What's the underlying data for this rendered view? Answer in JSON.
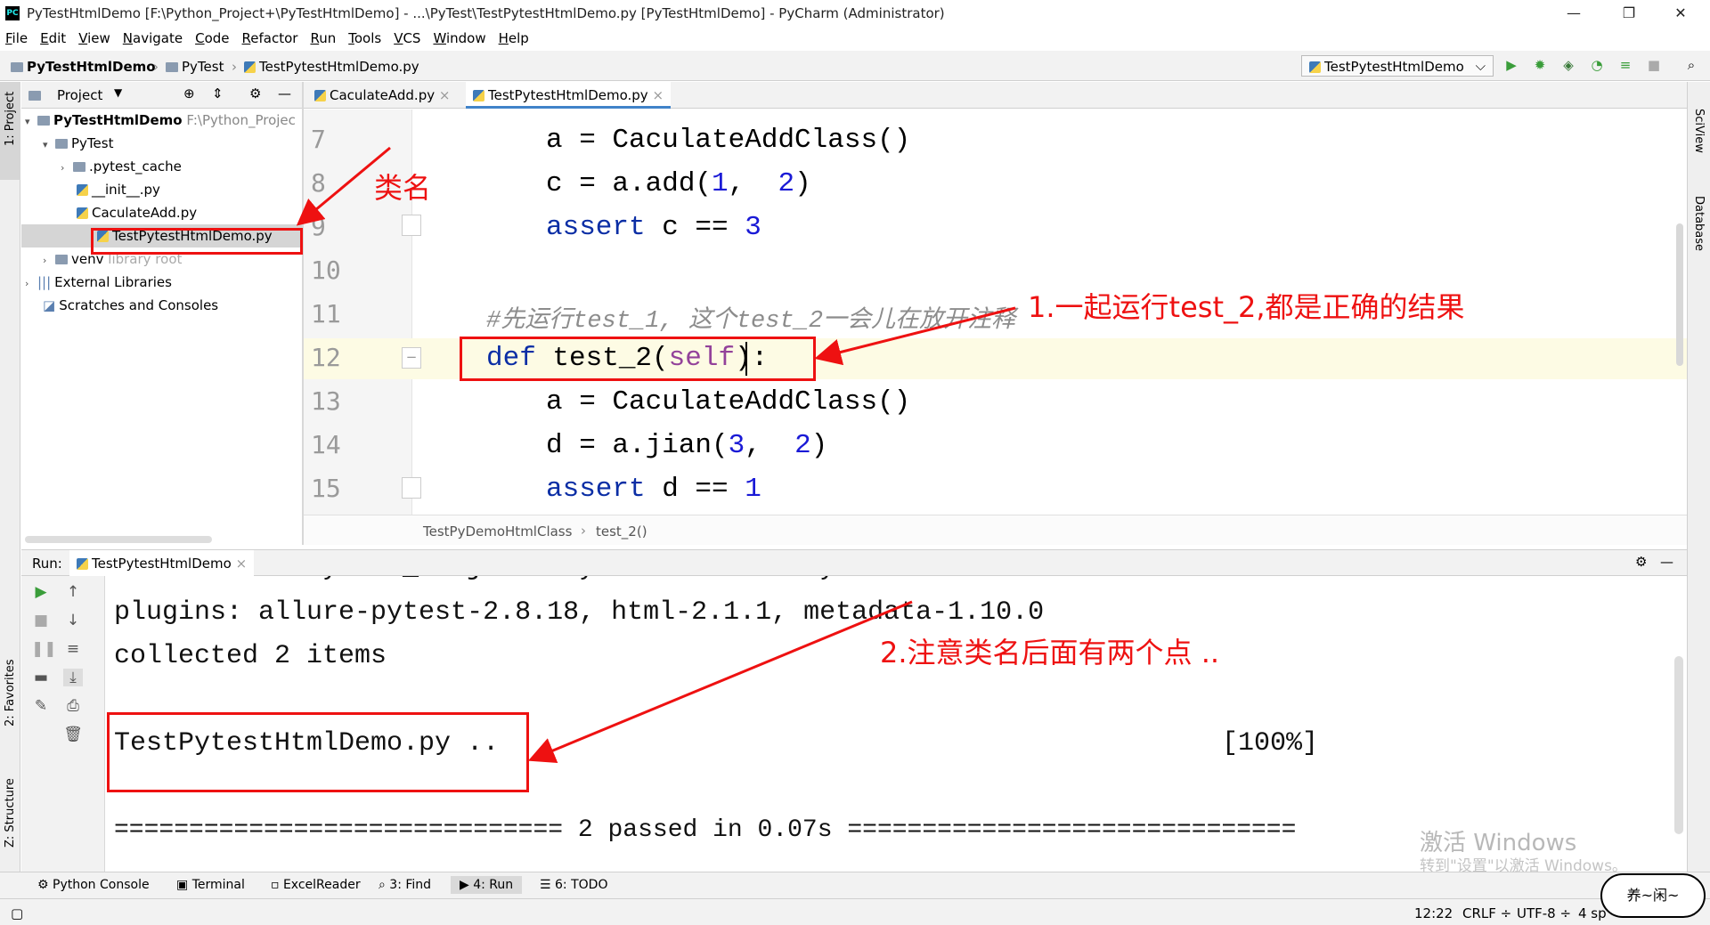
{
  "window": {
    "title": "PyTestHtmlDemo [F:\\Python_Project+\\PyTestHtmlDemo] - ...\\PyTest\\TestPytestHtmlDemo.py [PyTestHtmlDemo] - PyCharm (Administrator)",
    "app_icon": "PC",
    "minimize": "—",
    "restore": "❐",
    "close": "✕"
  },
  "menu": [
    "File",
    "Edit",
    "View",
    "Navigate",
    "Code",
    "Refactor",
    "Run",
    "Tools",
    "VCS",
    "Window",
    "Help"
  ],
  "breadcrumb": [
    "PyTestHtmlDemo",
    "PyTest",
    "TestPytestHtmlDemo.py"
  ],
  "run_config": "TestPytestHtmlDemo",
  "left_stripe": {
    "project": "1: Project",
    "favorites": "2: Favorites",
    "structure": "Z: Structure"
  },
  "right_stripe": {
    "sciview": "SciView",
    "database": "Database"
  },
  "project_panel": {
    "header": "Project",
    "tree": [
      {
        "label": "PyTestHtmlDemo",
        "hint": "F:\\Python_Projec",
        "bold": true
      },
      {
        "label": "PyTest"
      },
      {
        "label": ".pytest_cache"
      },
      {
        "label": "__init__.py"
      },
      {
        "label": "CaculateAdd.py"
      },
      {
        "label": "TestPytestHtmlDemo.py",
        "selected": true
      },
      {
        "label": "venv",
        "hint": "library root"
      },
      {
        "label": "External Libraries"
      },
      {
        "label": "Scratches and Consoles"
      }
    ]
  },
  "editor": {
    "tabs": [
      {
        "label": "CaculateAdd.py",
        "close": "×"
      },
      {
        "label": "TestPytestHtmlDemo.py",
        "close": "×",
        "active": true
      }
    ],
    "line_numbers": [
      "7",
      "8",
      "9",
      "10",
      "11",
      "12",
      "13",
      "14",
      "15"
    ],
    "lines": {
      "l7": [
        "a = ",
        "CaculateAddClass()"
      ],
      "l8": [
        "c = a.add(",
        "1",
        ",  ",
        "2",
        ")"
      ],
      "l9": [
        "assert",
        " c == ",
        "3"
      ],
      "l11": "#先运行test_1, 这个test_2一会儿在放开注释",
      "l12": [
        "def",
        " test_2(",
        "self",
        "):"
      ],
      "l13": [
        "a = ",
        "CaculateAddClass()"
      ],
      "l14": [
        "d = a.jian(",
        "3",
        ",  ",
        "2",
        ")"
      ],
      "l15": [
        "assert",
        " d == ",
        "1"
      ]
    },
    "crumb": [
      "TestPyDemoHtmlClass",
      "›",
      "test_2()"
    ]
  },
  "run_panel": {
    "label": "Run:",
    "tab": "TestPytestHtmlDemo",
    "tab_close": "×",
    "output": [
      "rootdir: F:\\Python_Project+\\PyTestHtmlDemo\\PyTest",
      "plugins: allure-pytest-2.8.18, html-2.1.1, metadata-1.10.0",
      "collected 2 items",
      "",
      "TestPytestHtmlDemo.py ..",
      "",
      "============================== 2 passed in 0.07s =============================="
    ],
    "progress": "[100%]"
  },
  "bottom_tabs": [
    "Python Console",
    "Terminal",
    "ExcelReader",
    "3: Find",
    "4: Run",
    "6: TODO"
  ],
  "status": {
    "position": "12:22",
    "line_sep": "CRLF ÷",
    "encoding": "UTF-8 ÷",
    "indent": "4 sp"
  },
  "annotations": {
    "classname": "类名",
    "note1": "1.一起运行test_2,都是正确的结果",
    "note2": "2.注意类名后面有两个点 .."
  },
  "watermark": {
    "line1": "激活 Windows",
    "line2": "转到\"设置\"以激活 Windows。"
  },
  "signature": "养~闲~"
}
